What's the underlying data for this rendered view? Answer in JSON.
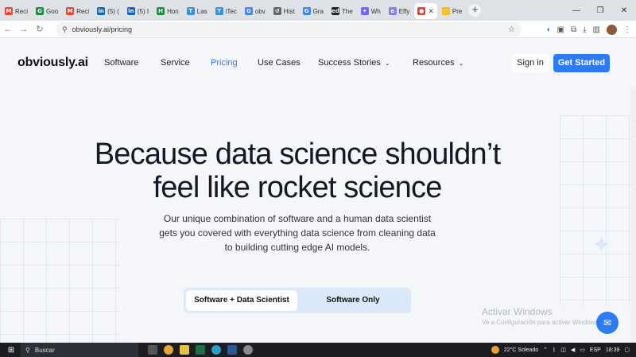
{
  "browser": {
    "tabs": [
      {
        "label": "Reci",
        "icon": "gmail-icon",
        "color": "#ea4335",
        "glyph": "M"
      },
      {
        "label": "Goo",
        "icon": "google-classroom-icon",
        "color": "#1e8e3e",
        "glyph": "G"
      },
      {
        "label": "Reci",
        "icon": "gmail-icon",
        "color": "#ea4335",
        "glyph": "M"
      },
      {
        "label": "(5) (",
        "icon": "linkedin-icon",
        "color": "#0a66c2",
        "glyph": "in"
      },
      {
        "label": "(5) I",
        "icon": "linkedin-icon",
        "color": "#0a66c2",
        "glyph": "in"
      },
      {
        "label": "Hon",
        "icon": "app-icon",
        "color": "#1e8e3e",
        "glyph": "H"
      },
      {
        "label": "Las",
        "icon": "itec-icon",
        "color": "#3b8fd6",
        "glyph": "T"
      },
      {
        "label": "iTec",
        "icon": "itec-icon",
        "color": "#3b8fd6",
        "glyph": "T"
      },
      {
        "label": "obv",
        "icon": "google-icon",
        "color": "#4285f4",
        "glyph": "G"
      },
      {
        "label": "Hist",
        "icon": "history-icon",
        "color": "#666666",
        "glyph": "↺"
      },
      {
        "label": "Gra",
        "icon": "google-icon",
        "color": "#4285f4",
        "glyph": "G"
      },
      {
        "label": "The",
        "icon": "ed-icon",
        "color": "#222222",
        "glyph": "ed"
      },
      {
        "label": "Wh",
        "icon": "app-icon",
        "color": "#7b61ff",
        "glyph": "✦"
      },
      {
        "label": "Effy",
        "icon": "effy-icon",
        "color": "#8a7df0",
        "glyph": "e"
      },
      {
        "label": "",
        "icon": "obviously-icon",
        "color": "#e0413a",
        "glyph": "●",
        "active": true
      },
      {
        "label": "Pre",
        "icon": "chrome-icon",
        "color": "#fbbc04",
        "glyph": "○"
      }
    ],
    "new_tab": "+",
    "url": "obviously.ai/pricing",
    "window_controls": [
      "⌄",
      "—",
      "❐",
      "✕"
    ]
  },
  "nav": {
    "logo": "obviously.ai",
    "items": [
      "Software",
      "Service",
      "Pricing",
      "Use Cases",
      "Success Stories",
      "Resources"
    ],
    "active": "Pricing",
    "signin": "Sign in",
    "get_started": "Get Started"
  },
  "hero": {
    "title_line1": "Because data science shouldn’t",
    "title_line2": "feel like rocket science",
    "subtitle": "Our unique combination of software and a human data scientist gets you covered with everything data science from cleaning data to building cutting edge AI models."
  },
  "toggle": {
    "option1": "Software + Data Scientist",
    "option2": "Software Only"
  },
  "watermark": {
    "line1": "Activar Windows",
    "line2": "Ve a Configuración para activar Windows."
  },
  "taskbar": {
    "search": "Buscar",
    "weather": "22°C  Soleado",
    "lang": "ESP",
    "time": "18:39"
  },
  "colors": {
    "accent": "#2d7bf4",
    "toggle_bg": "#dce9fb"
  }
}
